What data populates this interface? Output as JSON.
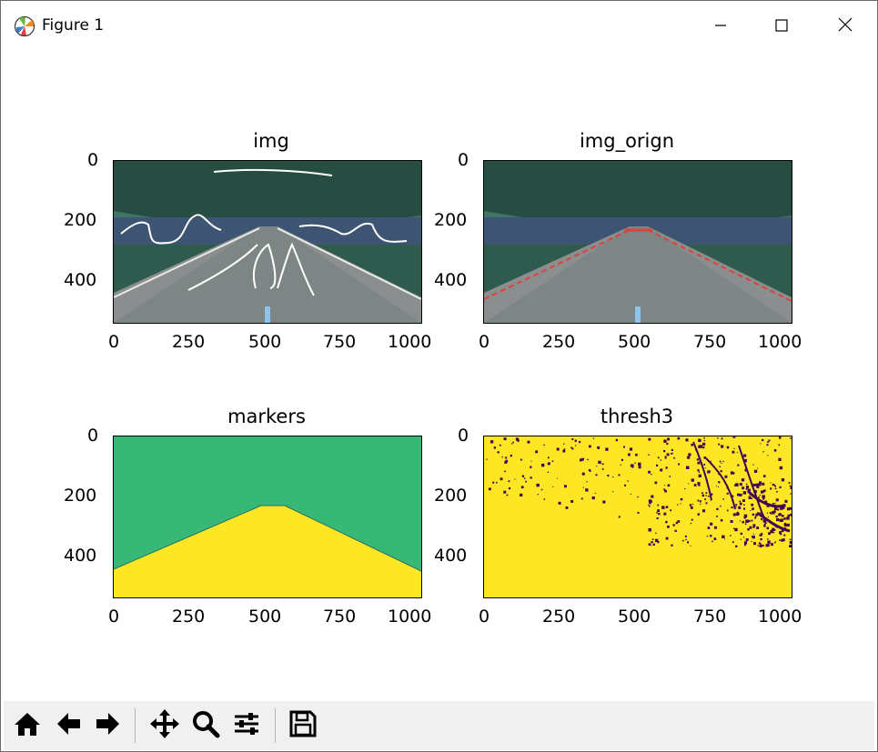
{
  "window": {
    "title": "Figure 1",
    "app_icon": "matplotlib-icon",
    "controls": [
      "minimize-icon",
      "maximize-icon",
      "close-icon"
    ]
  },
  "figure": {
    "panels": [
      {
        "title": "img",
        "image_content": "road-lined-with-trees-with-white-hand-drawn-strokes",
        "x_ticks": [
          "0",
          "250",
          "500",
          "750",
          "1000"
        ],
        "y_ticks": [
          "0",
          "200",
          "400"
        ]
      },
      {
        "title": "img_orign",
        "image_content": "road-lined-with-trees-with-red-dashed-lane-edges",
        "x_ticks": [
          "0",
          "250",
          "500",
          "750",
          "1000"
        ],
        "y_ticks": [
          "0",
          "200",
          "400"
        ]
      },
      {
        "title": "markers",
        "image_content": "green-background-with-yellow-road-region",
        "x_ticks": [
          "0",
          "250",
          "500",
          "750",
          "1000"
        ],
        "y_ticks": [
          "0",
          "200",
          "400"
        ]
      },
      {
        "title": "thresh3",
        "image_content": "yellow-binary-mask-with-dark-purple-noise",
        "x_ticks": [
          "0",
          "250",
          "500",
          "750",
          "1000"
        ],
        "y_ticks": [
          "0",
          "200",
          "400"
        ]
      }
    ]
  },
  "toolbar": {
    "buttons": [
      "home-icon",
      "back-icon",
      "forward-icon",
      "pan-icon",
      "zoom-icon",
      "configure-subplots-icon",
      "save-icon"
    ]
  },
  "colors": {
    "marker_green": "#37b877",
    "marker_yellow": "#fde725",
    "thresh_purple": "#440154",
    "lane_red": "#e0403a",
    "foliage": "#3c6f5e"
  }
}
